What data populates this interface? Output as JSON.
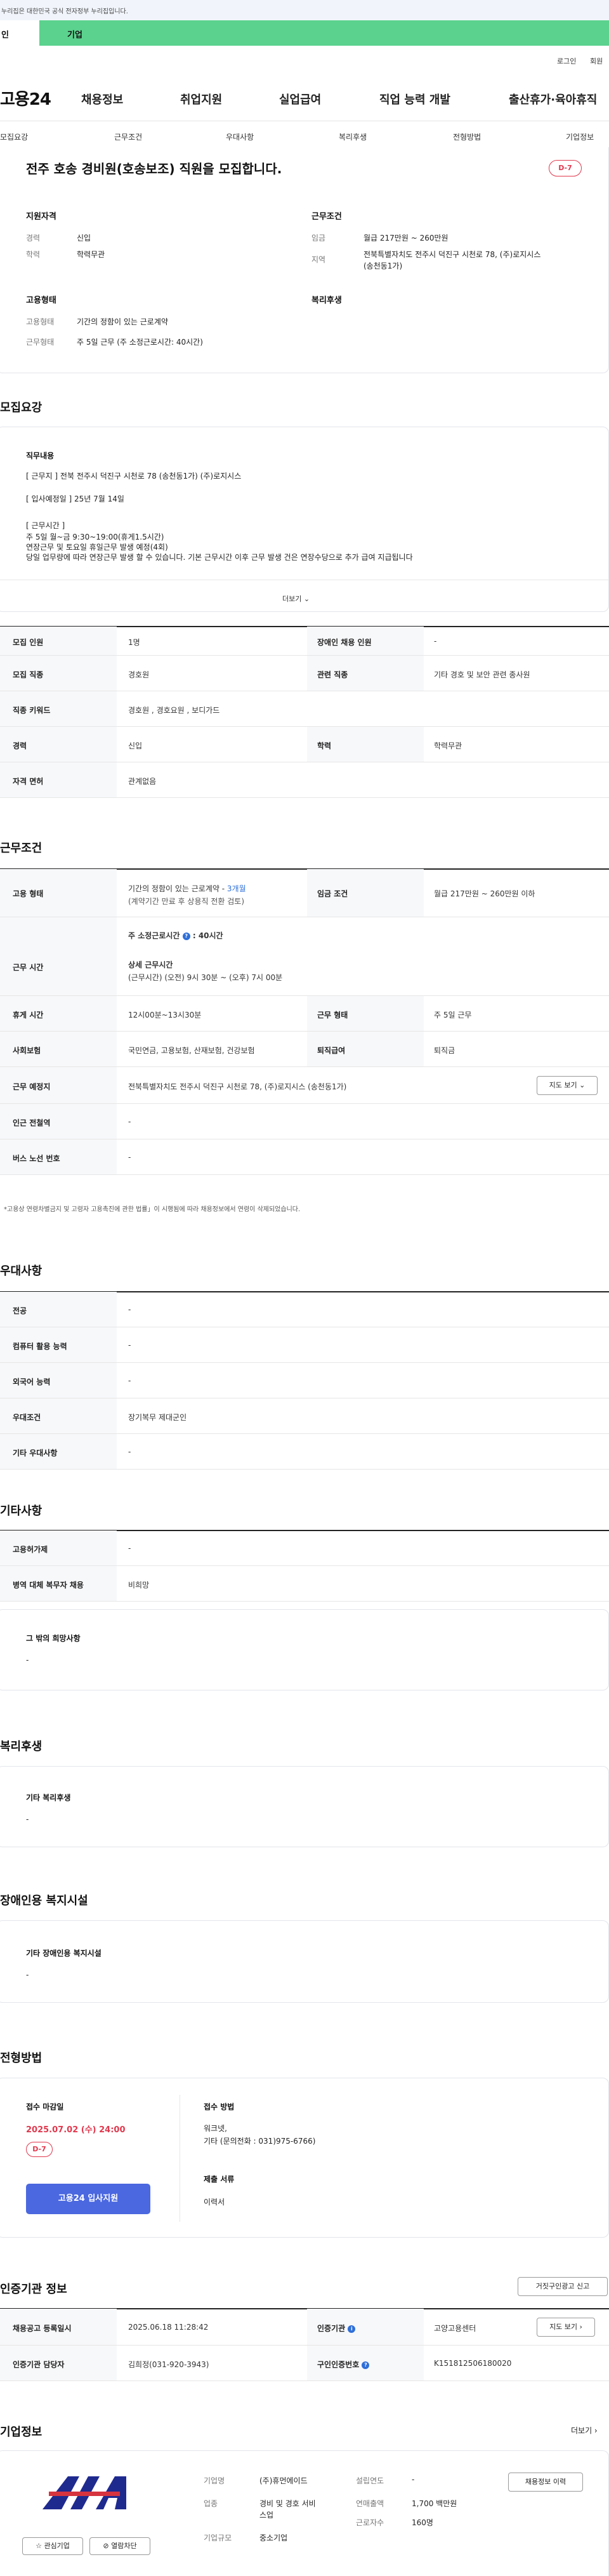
{
  "gov_bar": "누리집은 대한민국 공식 전자정부 누리집입니다.",
  "tabs": {
    "personal": "인",
    "company": "기업"
  },
  "util": {
    "login": "로그인",
    "signup": "회원"
  },
  "logo": "고용24",
  "gnb": [
    "채용정보",
    "취업지원",
    "실업급여",
    "직업 능력 개발",
    "출산휴가·육아휴직"
  ],
  "subnav": [
    "모집요강",
    "근무조건",
    "우대사항",
    "복리후생",
    "전형방법",
    "기업정보"
  ],
  "job": {
    "title": "전주 호송 경비원(호송보조) 직원을 모집합니다.",
    "dday": "D-7",
    "qual_title": "지원자격",
    "career_k": "경력",
    "career_v": "신입",
    "edu_k": "학력",
    "edu_v": "학력무관",
    "cond_title": "근무조건",
    "wage_k": "임금",
    "wage_v": "월급 217만원 ~ 260만원",
    "region_k": "지역",
    "region_v1": "전북특별자치도 전주시 덕진구 시천로 78, (주)로지시스",
    "region_v2": "(송천동1가)",
    "emp_title": "고용형태",
    "emp_k": "고용형태",
    "emp_v": "기간의 정함이 있는 근로계약",
    "hours_k": "근무형태",
    "hours_v": "주 5일 근무 (주 소정근로시간: 40시간)",
    "welfare_title": "복리후생"
  },
  "recruit": {
    "heading": "모집요강",
    "duty_title": "직무내용",
    "lines": [
      "[ 근무지 ] 전북 전주시 덕진구 시천로 78 (송천동1가) (주)로지시스",
      "[ 입사예정일 ] 25년 7월 14일",
      "[ 근무시간 ]",
      "주 5일 월~금 9:30~19:00(휴게1.5시간)",
      "연장근무 및 토요일 휴일근무 발생 예정(4회)",
      "당일 업무량에 따라 연장근무 발생 할 수 있습니다. 기본 근무시간 이후 근무 발생 건은 연장수당으로 추가 급여 지급됩니다"
    ],
    "more": "더보기 ⌄",
    "rows": [
      [
        "모집 인원",
        "1명",
        "장애인 채용 인원",
        "-"
      ],
      [
        "모집 직종",
        "경호원",
        "관련 직종",
        "기타 경호 및 보안 관련 종사원"
      ],
      [
        "직종 키워드",
        "경호원 , 경호요원 , 보디가드",
        "",
        ""
      ],
      [
        "경력",
        "신입",
        "학력",
        "학력무관"
      ],
      [
        "자격 면허",
        "관계없음",
        "",
        ""
      ]
    ]
  },
  "work": {
    "heading": "근무조건",
    "emp_k": "고용 형태",
    "emp_v1a": "기간의 정함이 있는 근로계약 - ",
    "emp_v1b": "3개월",
    "emp_v2": "(계약기간 만료 후 상용직 전환 검토)",
    "wage_k": "임금 조건",
    "wage_v": "월급 217만원 ~ 260만원 이하",
    "time_k": "근무 시간",
    "time_std": "주 소정근로시간",
    "time_std_v": ": 40시간",
    "time_detail_t": "상세 근무시간",
    "time_detail_v": "(근무시간) (오전) 9시 30분 ~ (오후) 7시 00분",
    "rest_k": "휴게 시간",
    "rest_v": "12시00분~13시30분",
    "form_k": "근무 형태",
    "form_v": "주 5일 근무",
    "ins_k": "사회보험",
    "ins_v": "국민연금, 고용보험, 산재보험, 건강보험",
    "sev_k": "퇴직급여",
    "sev_v": "퇴직금",
    "place_k": "근무 예정지",
    "place_v": "전북특별자치도 전주시 덕진구 시천로 78, (주)로지시스 (송천동1가)",
    "map_btn": "지도 보기 ⌄",
    "subway_k": "인근 전철역",
    "subway_v": "-",
    "bus_k": "버스 노선 번호",
    "bus_v": "-",
    "note": "*고용상 연령차별금지 및 고령자 고용촉진에 관한 법률」이 시행됨에 따라 채용정보에서 연령이 삭제되었습니다."
  },
  "pref": {
    "heading": "우대사항",
    "rows": [
      [
        "전공",
        "-"
      ],
      [
        "컴퓨터 활용 능력",
        "-"
      ],
      [
        "외국어 능력",
        "-"
      ],
      [
        "우대조건",
        "장기복무 제대군인"
      ],
      [
        "기타 우대사항",
        "-"
      ]
    ]
  },
  "etc": {
    "heading": "기타사항",
    "rows": [
      [
        "고용허가제",
        "-"
      ],
      [
        "병역 대체 복무자 채용",
        "비희망"
      ]
    ],
    "wish_title": "그 밖의 희망사항",
    "wish_v": "-"
  },
  "welfare": {
    "heading": "복리후생",
    "title": "기타 복리후생",
    "v": "-"
  },
  "disabled": {
    "heading": "장애인용 복지시설",
    "title": "기타 장애인용 복지시설",
    "v": "-"
  },
  "apply": {
    "heading": "전형방법",
    "deadline_t": "접수 마감일",
    "deadline_v": "2025.07.02 (수) 24:00",
    "dday": "D-7",
    "apply_btn": "고용24 입사지원",
    "method_t": "접수 방법",
    "method_v1": "워크넷,",
    "method_v2": "기타 (문의전화 : 031)975-6766)",
    "docs_t": "제출 서류",
    "docs_v": "이력서"
  },
  "agency": {
    "heading": "인증기관 정보",
    "report_btn": "거짓구인광고 신고",
    "rows": [
      [
        "채용공고 등록일시",
        "2025.06.18 11:28:42",
        "인증기관",
        "고양고용센터"
      ],
      [
        "인증기관 담당자",
        "김희정(031-920-3943)",
        "구인인증번호",
        "K151812506180020"
      ]
    ],
    "map_btn": "지도 보기 ›"
  },
  "company": {
    "heading": "기업정보",
    "more": "더보기 ›",
    "name_k": "기업명",
    "name_v": "(주)휴먼에이드",
    "ind_k": "업종",
    "ind_v1": "경비 및 경호 서비",
    "ind_v2": "스업",
    "size_k": "기업규모",
    "size_v": "중소기업",
    "found_k": "설립연도",
    "found_v": "-",
    "sales_k": "연매출액",
    "sales_v": "1,700 백만원",
    "emp_k": "근로자수",
    "emp_v": "160명",
    "fav_btn": "관심기업",
    "block_btn": "열람차단",
    "recruit_btn": "채용정보 이력"
  },
  "colors": {
    "accent": "#5bd28e",
    "red": "#e0394e",
    "blue": "#4b68e0"
  }
}
